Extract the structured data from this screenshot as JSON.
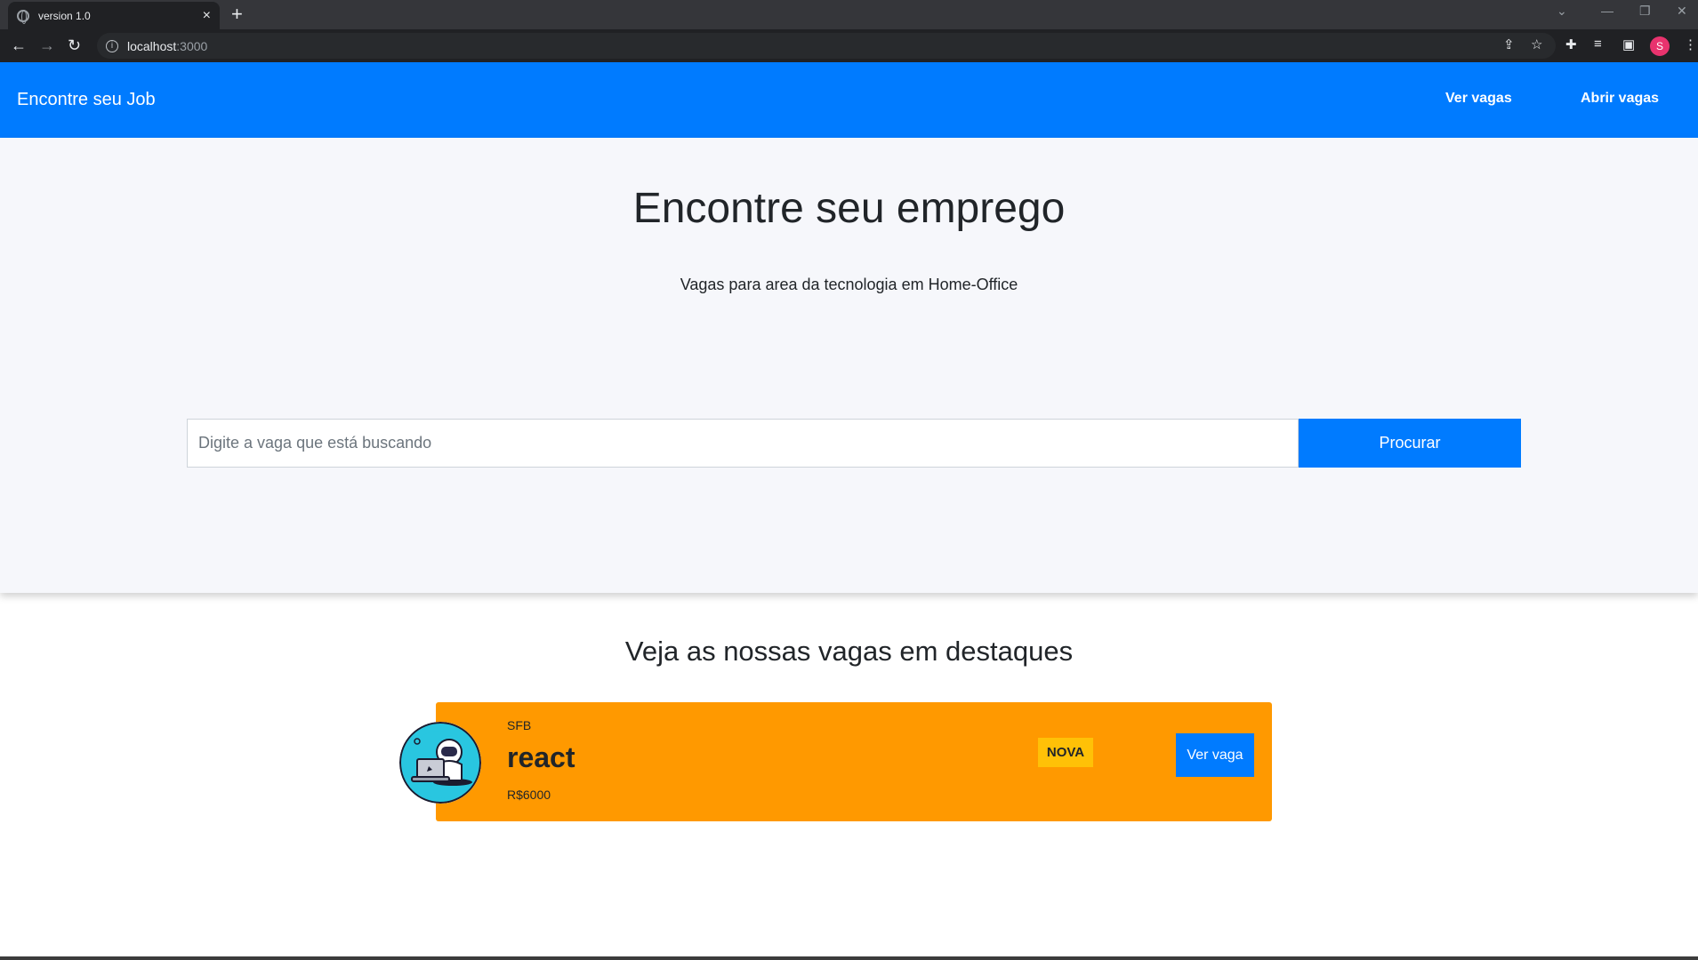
{
  "browser": {
    "tab_title": "version 1.0",
    "tab_close": "×",
    "new_tab": "+",
    "url_host": "localhost",
    "url_port": ":3000",
    "profile_initial": "S"
  },
  "header": {
    "brand": "Encontre seu Job",
    "nav": [
      "Ver vagas",
      "Abrir vagas"
    ]
  },
  "hero": {
    "title": "Encontre seu emprego",
    "subtitle": "Vagas para area da tecnologia em Home-Office",
    "search_placeholder": "Digite a vaga que está buscando",
    "search_button": "Procurar"
  },
  "featured": {
    "title": "Veja as nossas vagas em destaques",
    "jobs": [
      {
        "company": "SFB",
        "role": "react",
        "salary": "R$6000",
        "badge": "NOVA",
        "button": "Ver vaga"
      }
    ]
  },
  "colors": {
    "primary": "#007bff",
    "card": "#ff9900",
    "badge": "#ffc107",
    "hero_bg": "#f6f7fb"
  }
}
